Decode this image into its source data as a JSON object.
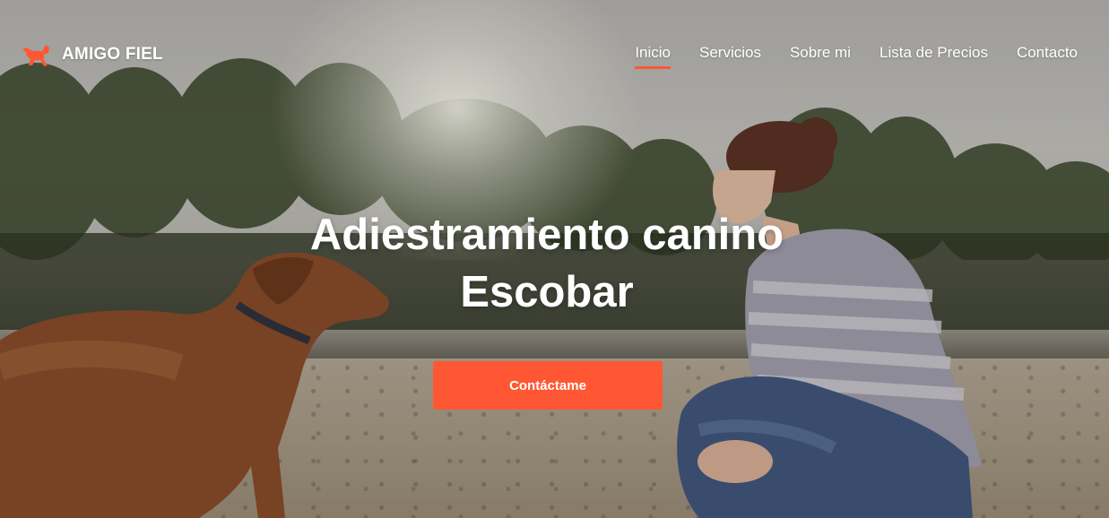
{
  "brand": {
    "name": "AMIGO FIEL",
    "logo_icon": "dog-icon",
    "accent_color": "#ff5733"
  },
  "nav": {
    "items": [
      {
        "label": "Inicio",
        "active": true
      },
      {
        "label": "Servicios",
        "active": false
      },
      {
        "label": "Sobre mi",
        "active": false
      },
      {
        "label": "Lista de Precios",
        "active": false
      },
      {
        "label": "Contacto",
        "active": false
      }
    ]
  },
  "hero": {
    "title_line1": "Adiestramiento canino",
    "title_line2": "Escobar",
    "cta_label": "Contáctame"
  }
}
